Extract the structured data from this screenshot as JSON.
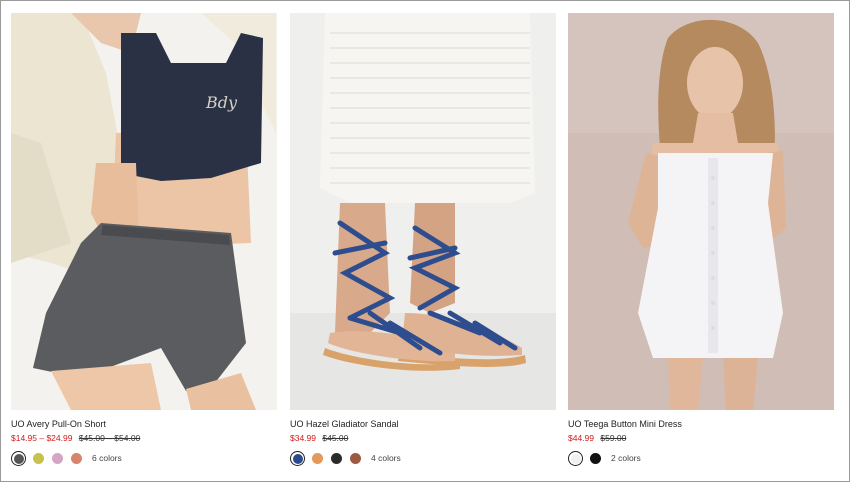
{
  "products": [
    {
      "name": "UO Avery Pull-On Short",
      "sale_price": "$14.95 – $24.99",
      "original_prices": "$45.00 – $54.00",
      "colors_label": "6 colors",
      "swatches": [
        "#555555",
        "#c8c24a",
        "#d3a6c4",
        "#d9836a"
      ]
    },
    {
      "name": "UO Hazel Gladiator Sandal",
      "sale_price": "$34.99",
      "original_prices": "$45.00",
      "colors_label": "4 colors",
      "swatches": [
        "#2c4a8a",
        "#e3985c",
        "#2b2b2b",
        "#9c5a45"
      ]
    },
    {
      "name": "UO Teega Button Mini Dress",
      "sale_price": "$44.99",
      "original_prices": "$59.00",
      "colors_label": "2 colors",
      "swatches": [
        "#f0f0f0",
        "#111111"
      ]
    }
  ]
}
